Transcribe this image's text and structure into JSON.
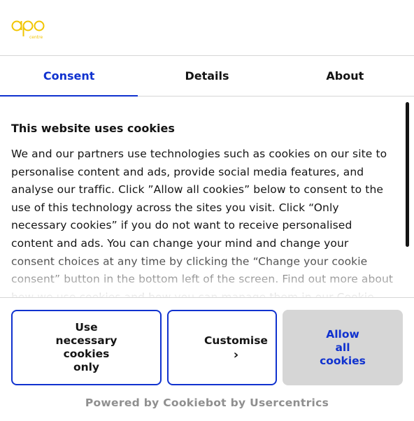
{
  "brand": {
    "logo_text": "centre",
    "logo_color": "#f2c500"
  },
  "tabs": [
    {
      "label": "Consent",
      "active": true
    },
    {
      "label": "Details",
      "active": false
    },
    {
      "label": "About",
      "active": false
    }
  ],
  "consent": {
    "heading": "This website uses cookies",
    "paragraph": "We and our partners use technologies such as cookies on our site to personalise content and ads, provide social media features, and analyse our traffic. Click ”Allow all cookies” below to consent to the use of this technology across the sites you visit. Click “Only necessary cookies” if you do not want to receive personalised content and ads.  You can change your mind and change your consent choices at any time by clicking the “Change your cookie consent” button in the bottom left of the screen. Find out more about how we use cookies and how you can manage them in our Cookie Policy."
  },
  "buttons": {
    "necessary": "Use necessary cookies only",
    "customise": "Customise",
    "customise_chevron": "›",
    "allow_all": "Allow all cookies"
  },
  "footer": {
    "powered_by": "Powered by Cookiebot by Usercentrics"
  },
  "colors": {
    "accent": "#1032cf",
    "muted": "#8f8f8f",
    "divider": "#d6d6d6"
  }
}
